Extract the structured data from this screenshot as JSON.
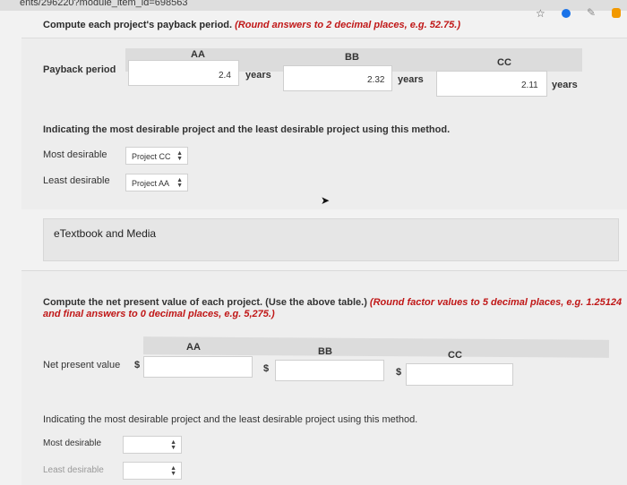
{
  "browser": {
    "url": "ents/296220?module_item_id=698563"
  },
  "section1": {
    "prompt": "Compute each project's payback period.",
    "prompt_note": "(Round answers to 2 decimal places, e.g. 52.75.)",
    "columns": [
      "AA",
      "BB",
      "CC"
    ],
    "row_label": "Payback period",
    "values": [
      "2.4",
      "2.32",
      "2.11"
    ],
    "unit": "years",
    "indicate_text": "Indicating the most desirable project and the least desirable project using this method.",
    "most_label": "Most desirable",
    "most_value": "Project CC",
    "least_label": "Least desirable",
    "least_value": "Project AA"
  },
  "etextbook": {
    "label": "eTextbook and Media"
  },
  "section2": {
    "prompt": "Compute the net present value of each project. (Use the above table.)",
    "prompt_note": "(Round factor values to 5 decimal places, e.g. 1.25124 and final answers to 0 decimal places, e.g. 5,275.)",
    "columns": [
      "AA",
      "BB",
      "CC"
    ],
    "row_label": "Net present value",
    "currency": "$",
    "values": [
      "",
      "",
      ""
    ],
    "indicate_text": "Indicating the most desirable project and the least desirable project using this method.",
    "most_label": "Most desirable",
    "most_value": "",
    "least_label": "Least desirable",
    "least_value": ""
  },
  "icons": {
    "star": "star-icon",
    "arrow": "cursor-icon",
    "select_arrow": "updown-chevron-icon"
  }
}
